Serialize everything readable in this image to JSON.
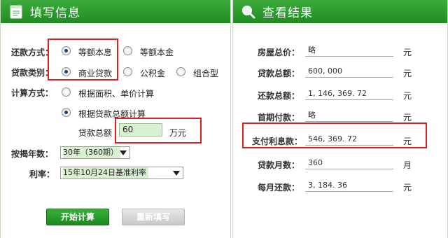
{
  "left_panel": {
    "title": "填写信息",
    "repay_method": {
      "label": "还款方式：",
      "options": [
        "等额本息",
        "等额本金"
      ]
    },
    "loan_type": {
      "label": "贷款类别：",
      "options": [
        "商业贷款",
        "公积金",
        "组合型"
      ]
    },
    "calc_method": {
      "label": "计算方式：",
      "options": [
        "根据面积、单价计算",
        "根据贷款总额计算"
      ]
    },
    "loan_total": {
      "label": "贷款总额",
      "value": "60",
      "unit": "万元"
    },
    "term": {
      "label": "按揭年数：",
      "value": "30年（360期）"
    },
    "rate": {
      "label": "利率：",
      "value": "15年10月24日基准利率"
    },
    "buttons": {
      "start": "开始计算",
      "reset": "重新填写"
    }
  },
  "right_panel": {
    "title": "查看结果",
    "rows": [
      {
        "label": "房屋总价：",
        "value": "略",
        "unit": "元"
      },
      {
        "label": "贷款总额：",
        "value": "600, 000",
        "unit": "元"
      },
      {
        "label": "还款总额：",
        "value": "1, 146, 369. 72",
        "unit": "元"
      },
      {
        "label": "首期付款：",
        "value": "略",
        "unit": "元"
      },
      {
        "label": "支付利息款：",
        "value": "546, 369. 72",
        "unit": "元"
      },
      {
        "label": "贷款月数：",
        "value": "360",
        "unit": "月"
      },
      {
        "label": "每月还款：",
        "value": "3, 184. 36",
        "unit": "元"
      }
    ]
  },
  "colors": {
    "header_green": "#2a9a2c",
    "highlight_red": "#e02020",
    "field_green": "#d9f0d3"
  },
  "icons": {
    "left_header": "form-icon",
    "right_header": "search-icon"
  }
}
